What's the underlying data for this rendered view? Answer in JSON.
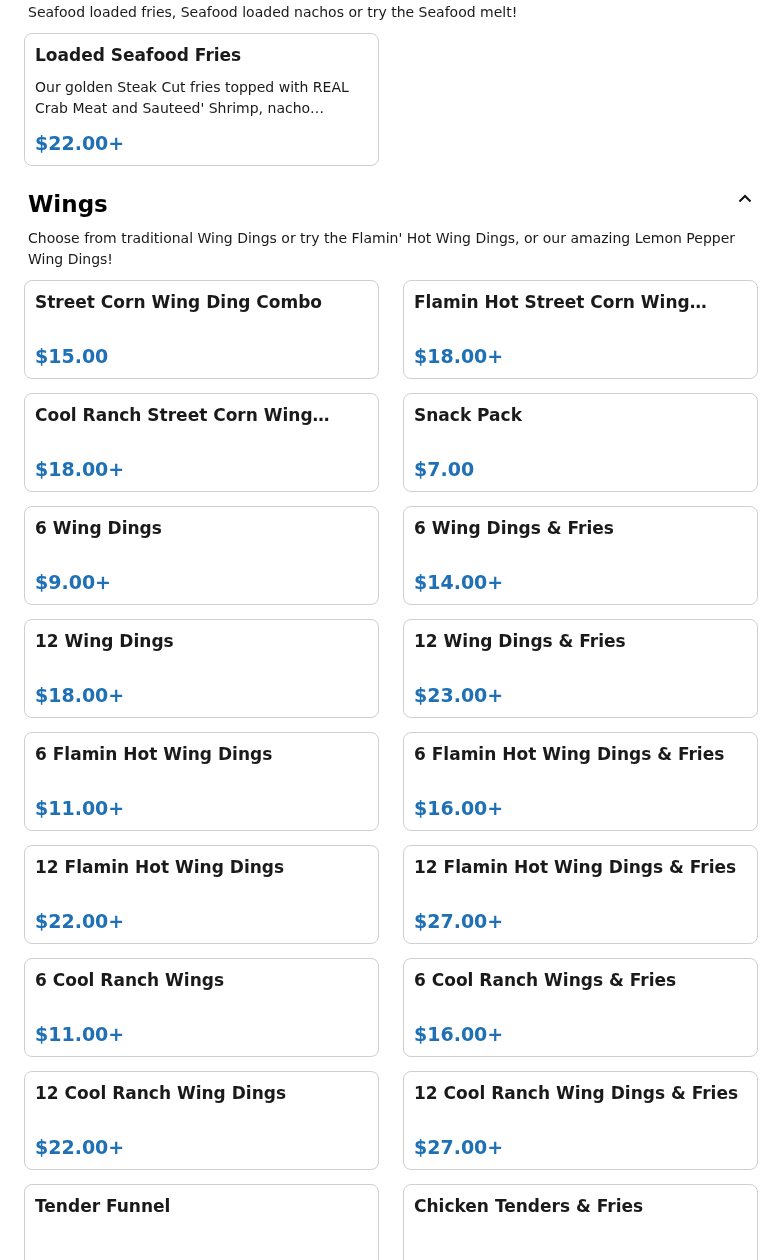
{
  "previous_section": {
    "description": "Seafood loaded fries, Seafood loaded nachos or try the Seafood melt!",
    "items": [
      {
        "name": "Loaded Seafood Fries",
        "description": "Our golden Steak Cut fries topped with REAL Crab Meat and Sauteed' Shrimp, nacho…",
        "price": "$22.00+"
      }
    ]
  },
  "section": {
    "title": "Wings",
    "expanded": true,
    "description": "Choose from traditional Wing Dings or try the Flamin' Hot Wing Dings, or our amazing Lemon Pepper Wing Dings!",
    "items": [
      {
        "name": "Street Corn Wing Ding Combo",
        "price": "$15.00"
      },
      {
        "name": "Flamin Hot Street Corn Wing…",
        "price": "$18.00+"
      },
      {
        "name": "Cool Ranch Street Corn Wing…",
        "price": "$18.00+"
      },
      {
        "name": "Snack Pack",
        "price": "$7.00"
      },
      {
        "name": "6 Wing Dings",
        "price": "$9.00+"
      },
      {
        "name": "6 Wing Dings & Fries",
        "price": "$14.00+"
      },
      {
        "name": "12 Wing Dings",
        "price": "$18.00+"
      },
      {
        "name": "12 Wing Dings & Fries",
        "price": "$23.00+"
      },
      {
        "name": "6 Flamin Hot Wing Dings",
        "price": "$11.00+"
      },
      {
        "name": "6 Flamin Hot Wing Dings & Fries",
        "price": "$16.00+"
      },
      {
        "name": "12 Flamin Hot Wing Dings",
        "price": "$22.00+"
      },
      {
        "name": "12 Flamin Hot Wing Dings & Fries",
        "price": "$27.00+"
      },
      {
        "name": "6 Cool Ranch Wings",
        "price": "$11.00+"
      },
      {
        "name": "6 Cool Ranch Wings & Fries",
        "price": "$16.00+"
      },
      {
        "name": "12 Cool Ranch Wing Dings",
        "price": "$22.00+"
      },
      {
        "name": "12 Cool Ranch Wing Dings & Fries",
        "price": "$27.00+"
      },
      {
        "name": "Tender Funnel"
      },
      {
        "name": "Chicken Tenders & Fries"
      }
    ]
  }
}
